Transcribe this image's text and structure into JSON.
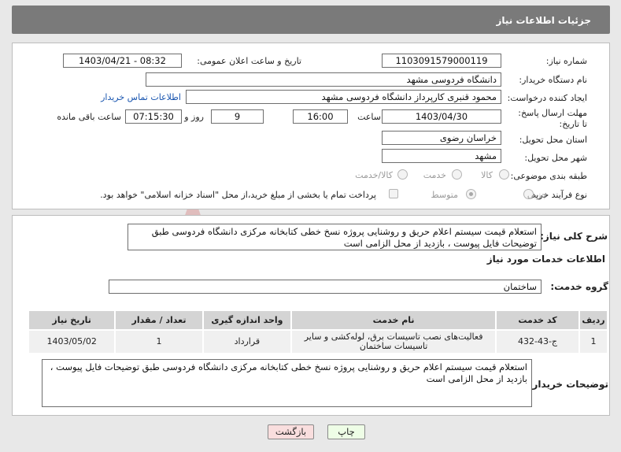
{
  "header": {
    "title": "جزئیات اطلاعات نیاز"
  },
  "form": {
    "need_number_label": "شماره نیاز:",
    "need_number": "1103091579000119",
    "announce_label": "تاریخ و ساعت اعلان عمومی:",
    "announce_value": "1403/04/21 - 08:32",
    "buyer_label": "نام دستگاه خریدار:",
    "buyer": "دانشگاه فردوسی مشهد",
    "creator_label": "ایجاد کننده درخواست:",
    "creator": "محمود قنبری کارپرداز دانشگاه فردوسی مشهد",
    "contact_link": "اطلاعات تماس خریدار",
    "deadline_label": "مهلت ارسال پاسخ: تا تاریخ:",
    "deadline_date": "1403/04/30",
    "time_label": "ساعت",
    "deadline_time": "16:00",
    "days_value": "9",
    "days_label": "روز و",
    "remaining_time": "07:15:30",
    "remaining_label": "ساعت باقی مانده",
    "province_label": "استان محل تحویل:",
    "province": "خراسان رضوی",
    "city_label": "شهر محل تحویل:",
    "city": "مشهد",
    "category_label": "طبقه بندی موضوعی:",
    "category_options": [
      "کالا",
      "خدمت",
      "کالا/خدمت"
    ],
    "process_label": "نوع فرآیند خرید :",
    "process_options": [
      "جزیی",
      "متوسط"
    ],
    "payment_note": "پرداخت تمام یا بخشی از مبلغ خرید،از محل \"اسناد خزانه اسلامی\" خواهد بود."
  },
  "summary": {
    "label": "شرح کلی نیاز:",
    "text": "استعلام قیمت سیستم اعلام حریق و روشنایی پروژه نسخ خطی کتابخانه مرکزی دانشگاه فردوسی طبق توضیحات فایل پیوست ، بازدید از محل الزامی است"
  },
  "services": {
    "section_title": "اطلاعات خدمات مورد نیاز",
    "group_label": "گروه خدمت:",
    "group_value": "ساختمان",
    "columns": [
      "ردیف",
      "کد خدمت",
      "نام خدمت",
      "واحد اندازه گیری",
      "تعداد / مقدار",
      "تاریخ نیاز"
    ],
    "rows": [
      [
        "1",
        "ج-43-432",
        "فعالیت‌های نصب تاسیسات برق، لوله‌کشی و سایر تاسیسات ساختمان",
        "قرارداد",
        "1",
        "1403/05/02"
      ]
    ]
  },
  "buyer_notes": {
    "label": "توضیحات خریدار:",
    "text": "استعلام قیمت سیستم اعلام حریق و روشنایی پروژه نسخ خطی کتابخانه مرکزی دانشگاه فردوسی طبق توضیحات فایل پیوست ، بازدید از محل الزامی است"
  },
  "buttons": {
    "print": "چاپ",
    "back": "بازگشت"
  },
  "colors": {
    "header_bg": "#7a7a7a",
    "link": "#1a56b0",
    "back_button_bg": "#f9dede",
    "print_button_bg": "#eefde6",
    "watermark": "#c62828"
  },
  "watermark": {
    "text": "AriaTender.neT"
  }
}
